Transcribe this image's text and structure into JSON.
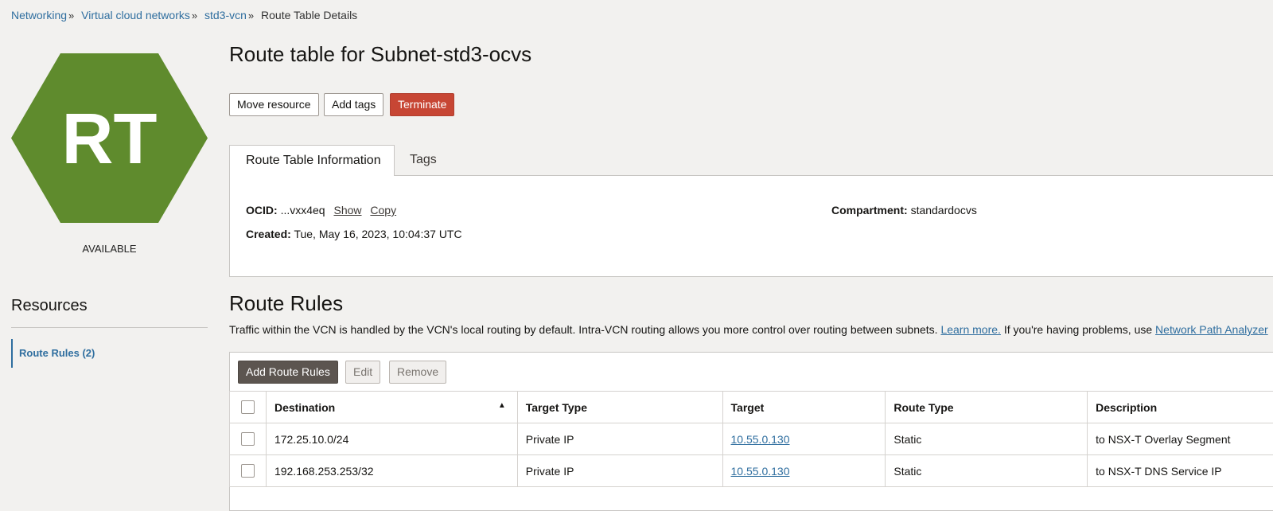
{
  "breadcrumb": {
    "items": [
      "Networking",
      "Virtual cloud networks",
      "std3-vcn"
    ],
    "current": "Route Table Details",
    "separator": "»"
  },
  "resource_icon": {
    "text": "RT",
    "color": "#5f8b2d"
  },
  "status": "AVAILABLE",
  "page_title": "Route table for Subnet-std3-ocvs",
  "actions": {
    "move": "Move resource",
    "tags": "Add tags",
    "terminate": "Terminate"
  },
  "tabs": {
    "info": "Route Table Information",
    "tags": "Tags"
  },
  "info": {
    "ocid_label": "OCID:",
    "ocid_value": "...vxx4eq",
    "show": "Show",
    "copy": "Copy",
    "created_label": "Created:",
    "created_value": "Tue, May 16, 2023, 10:04:37 UTC",
    "compartment_label": "Compartment:",
    "compartment_value": "standardocvs"
  },
  "resources": {
    "title": "Resources",
    "items": [
      "Route Rules (2)"
    ]
  },
  "route_rules": {
    "title": "Route Rules",
    "desc_text": "Traffic within the VCN is handled by the VCN's local routing by default. Intra-VCN routing allows you more control over routing between subnets.",
    "learn_more": "Learn more.",
    "desc_text2": "If you're having problems, use",
    "analyzer": "Network Path Analyzer",
    "add_button": "Add Route Rules",
    "edit_button": "Edit",
    "remove_button": "Remove",
    "columns": [
      "Destination",
      "Target Type",
      "Target",
      "Route Type",
      "Description"
    ],
    "sort_icon": "sort-ascending-icon",
    "rows": [
      {
        "destination": "172.25.10.0/24",
        "target_type": "Private IP",
        "target": "10.55.0.130",
        "route_type": "Static",
        "description": "to NSX-T Overlay Segment"
      },
      {
        "destination": "192.168.253.253/32",
        "target_type": "Private IP",
        "target": "10.55.0.130",
        "route_type": "Static",
        "description": "to NSX-T DNS Service IP"
      }
    ]
  }
}
